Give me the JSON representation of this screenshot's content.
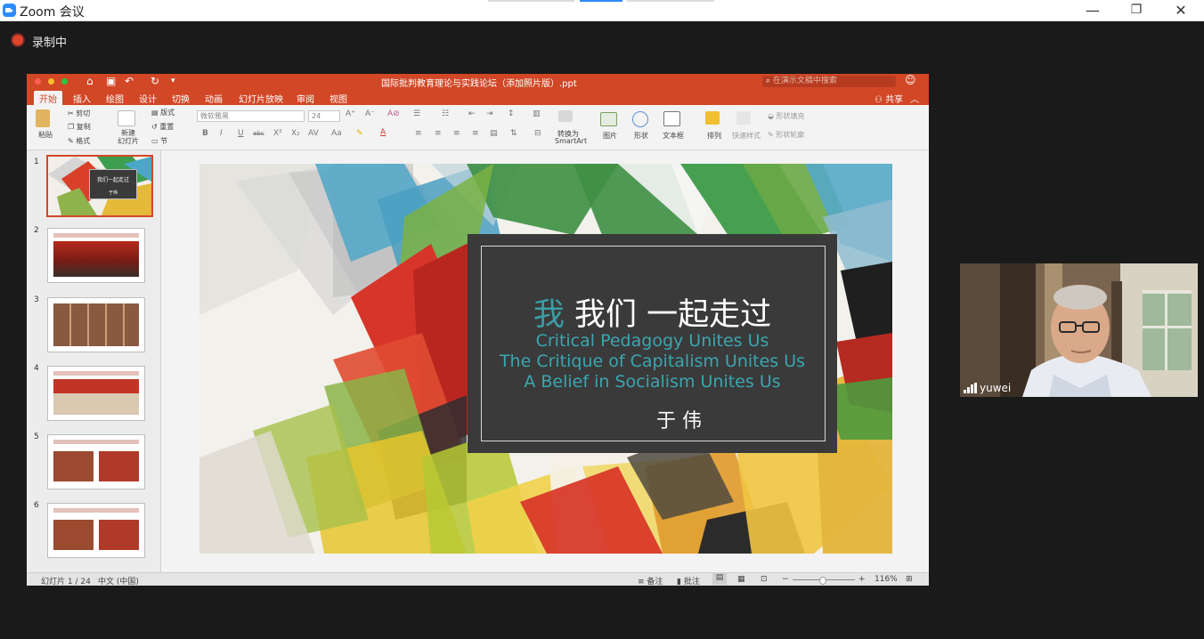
{
  "zoom": {
    "title": "Zoom 会议",
    "recording_label": "录制中",
    "window_controls": {
      "minimize": "—",
      "maximize": "❐",
      "close": "✕"
    }
  },
  "ppt": {
    "doc_title": "国际批判教育理论与实践论坛（添加照片版）.ppt",
    "search_placeholder": "在演示文稿中搜索",
    "tabs": [
      "开始",
      "插入",
      "绘图",
      "设计",
      "切换",
      "动画",
      "幻灯片放映",
      "审阅",
      "视图"
    ],
    "share_label": "共享",
    "ribbon": {
      "paste": "粘贴",
      "cut": "剪切",
      "copy": "复制",
      "format": "格式",
      "new_slide_line1": "新建",
      "new_slide_line2": "幻灯片",
      "layout": "版式",
      "reset": "重置",
      "section": "节",
      "font_name": "微软雅黑",
      "font_size": "24",
      "convert_line1": "转换为",
      "convert_line2": "SmartArt",
      "picture": "图片",
      "shape": "形状",
      "textbox": "文本框",
      "arrange": "排列",
      "quick_styles": "快速样式",
      "shape_fill": "形状填充",
      "shape_outline": "形状轮廓"
    },
    "thumbnails": [
      {
        "num": "1",
        "title": "我们一起走过",
        "author": "于伟"
      },
      {
        "num": "2"
      },
      {
        "num": "3"
      },
      {
        "num": "4"
      },
      {
        "num": "5"
      },
      {
        "num": "6"
      }
    ],
    "slide": {
      "title_accent": "我",
      "title_rest": " 我们 一起走过",
      "lines": [
        "Critical Pedagogy Unites Us",
        "The Critique of Capitalism Unites Us",
        "A Belief in Socialism Unites Us"
      ],
      "author": "于 伟"
    },
    "status": {
      "slide_counter": "幻灯片 1 / 24",
      "language": "中文 (中国)",
      "notes": "备注",
      "comments": "批注",
      "zoom_level": "116%",
      "zoom_fraction": 0.47
    }
  },
  "video": {
    "participant_name": "yuwei"
  },
  "colors": {
    "ppt_accent": "#d24726",
    "slide_teal": "#3aa6b0",
    "recording_red": "#e0442b"
  }
}
